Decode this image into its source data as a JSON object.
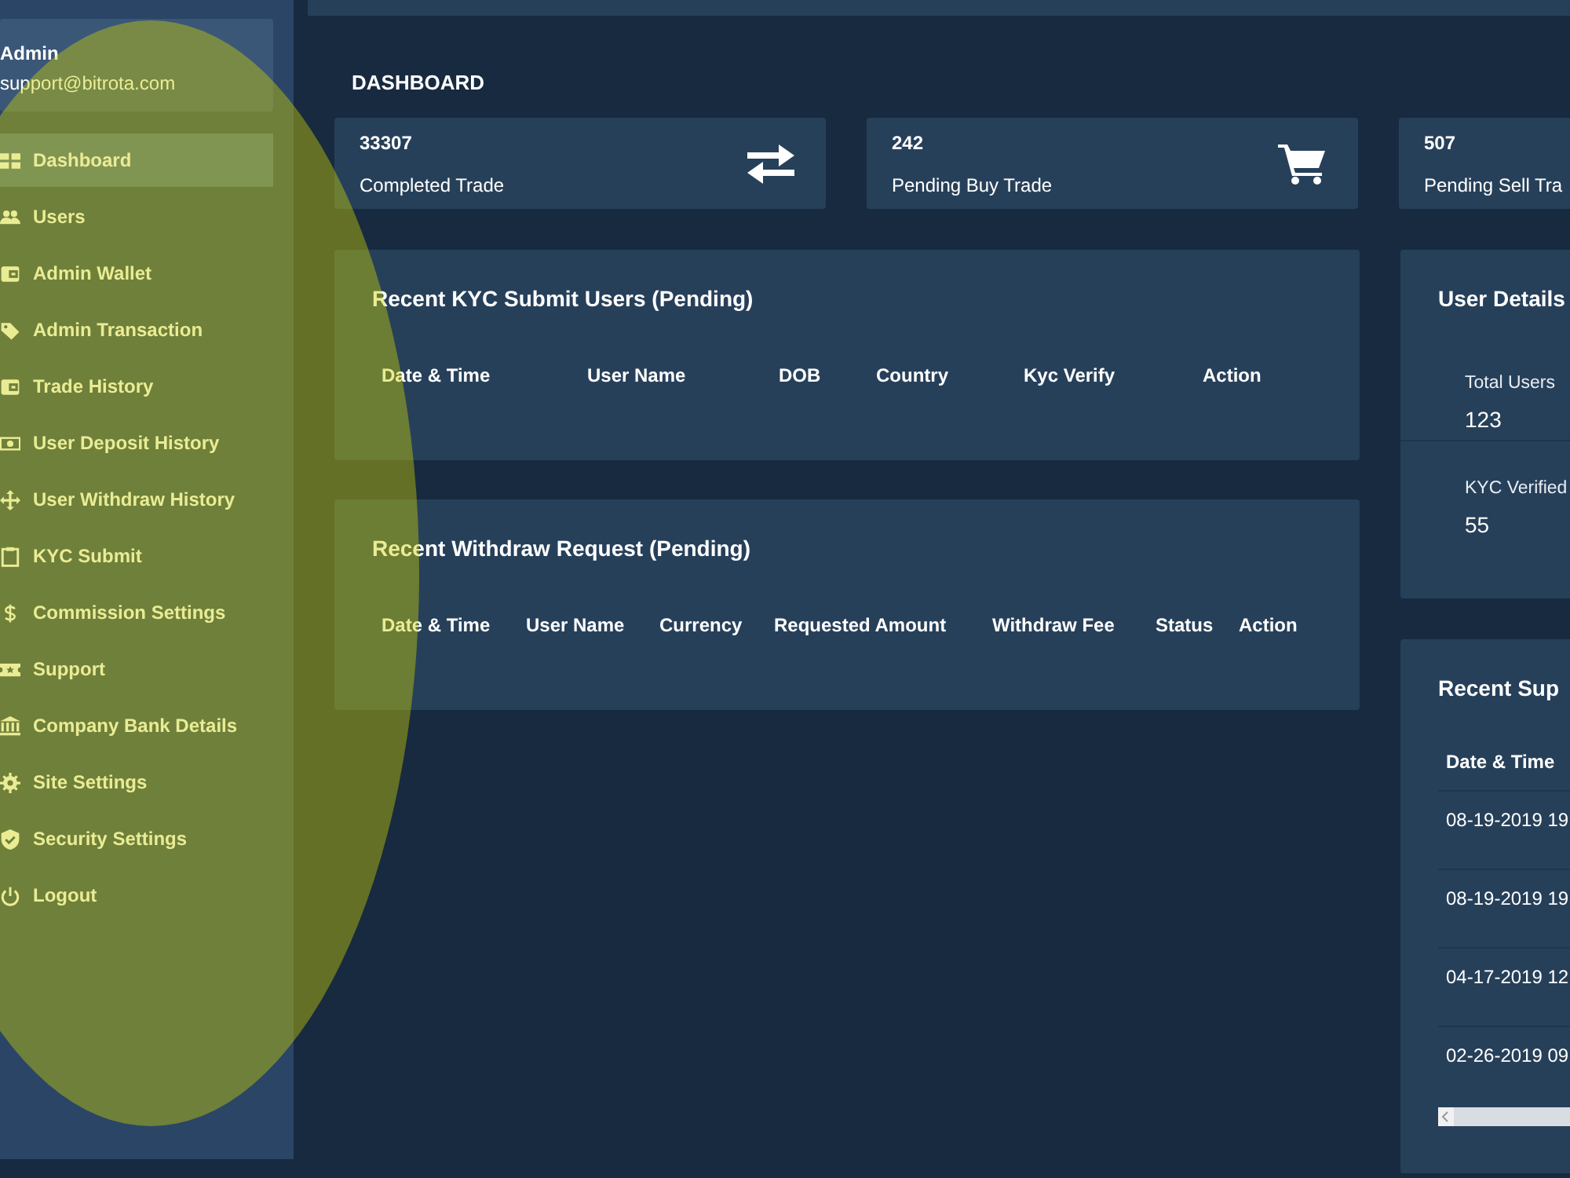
{
  "sidebar": {
    "profile": {
      "name": "Admin",
      "email": "support@bitrota.com"
    },
    "items": [
      {
        "label": "Dashboard",
        "selected": true
      },
      {
        "label": "Users",
        "selected": false
      },
      {
        "label": "Admin Wallet",
        "selected": false
      },
      {
        "label": "Admin Transaction",
        "selected": false
      },
      {
        "label": "Trade History",
        "selected": false
      },
      {
        "label": "User Deposit History",
        "selected": false
      },
      {
        "label": "User Withdraw History",
        "selected": false
      },
      {
        "label": "KYC Submit",
        "selected": false
      },
      {
        "label": "Commission Settings",
        "selected": false
      },
      {
        "label": "Support",
        "selected": false
      },
      {
        "label": "Company Bank Details",
        "selected": false
      },
      {
        "label": "Site Settings",
        "selected": false
      },
      {
        "label": "Security Settings",
        "selected": false
      },
      {
        "label": "Logout",
        "selected": false
      }
    ]
  },
  "page_title": "DASHBOARD",
  "stats": [
    {
      "value": "33307",
      "label": "Completed Trade",
      "kind": "exchange"
    },
    {
      "value": "242",
      "label": "Pending Buy Trade",
      "kind": "cart"
    },
    {
      "value": "507",
      "label": "Pending Sell Tra",
      "kind": "hidden"
    }
  ],
  "kyc_table": {
    "title": "Recent KYC Submit Users (Pending)",
    "columns": [
      "Date & Time",
      "User Name",
      "DOB",
      "Country",
      "Kyc Verify",
      "Action"
    ]
  },
  "withdraw_table": {
    "title": "Recent Withdraw Request (Pending)",
    "columns": [
      "Date & Time",
      "User Name",
      "Currency",
      "Requested Amount",
      "Withdraw Fee",
      "Status",
      "Action"
    ]
  },
  "user_details": {
    "title": "User Details",
    "stats": [
      {
        "label": "Total Users",
        "value": "123"
      },
      {
        "label": "KYC Verified",
        "value": "55"
      }
    ]
  },
  "support_table": {
    "title": "Recent Sup",
    "columns": [
      "Date & Time"
    ],
    "rows": [
      [
        "08-19-2019 19"
      ],
      [
        "08-19-2019 19"
      ],
      [
        "04-17-2019 12"
      ],
      [
        "02-26-2019 09"
      ]
    ]
  },
  "highlight": {
    "kind": "ellipse"
  }
}
